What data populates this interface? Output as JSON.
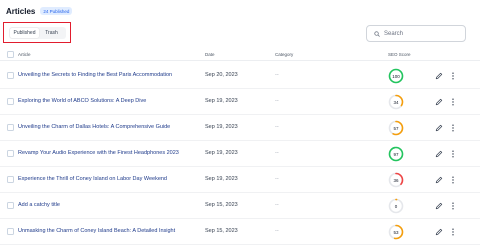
{
  "header": {
    "title": "Articles",
    "badge": "24 Published"
  },
  "tabs": [
    {
      "label": "Published",
      "active": true
    },
    {
      "label": "Trash",
      "active": false
    }
  ],
  "search": {
    "placeholder": "Search"
  },
  "table": {
    "columns": {
      "article": "Article",
      "date": "Date",
      "category": "Category",
      "seo": "SEO Score"
    },
    "rows": [
      {
        "title": "Unveiling the Secrets to Finding the Best Paris Accommodation",
        "date": "Sep 20, 2023",
        "category": "--",
        "score": "100",
        "score_value": 100,
        "color": "#22c55e"
      },
      {
        "title": "Exploring the World of ABCO Solutions: A Deep Dive",
        "date": "Sep 19, 2023",
        "category": "--",
        "score": "34",
        "score_value": 34,
        "color": "#f59e0b"
      },
      {
        "title": "Unveiling the Charm of Dallas Hotels: A Comprehensive Guide",
        "date": "Sep 19, 2023",
        "category": "--",
        "score": "57",
        "score_value": 57,
        "color": "#f59e0b"
      },
      {
        "title": "Revamp Your Audio Experience with the Finest Headphones 2023",
        "date": "Sep 19, 2023",
        "category": "--",
        "score": "97",
        "score_value": 97,
        "color": "#22c55e"
      },
      {
        "title": "Experience the Thrill of Coney Island on Labor Day Weekend",
        "date": "Sep 19, 2023",
        "category": "--",
        "score": "36",
        "score_value": 36,
        "color": "#ef4444"
      },
      {
        "title": "Add a catchy title",
        "date": "Sep 15, 2023",
        "category": "--",
        "score": "0",
        "score_value": 0,
        "color": "#f59e0b"
      },
      {
        "title": "Unmasking the Charm of Coney Island Beach: A Detailed Insight",
        "date": "Sep 15, 2023",
        "category": "--",
        "score": "53",
        "score_value": 53,
        "color": "#f59e0b"
      }
    ]
  }
}
